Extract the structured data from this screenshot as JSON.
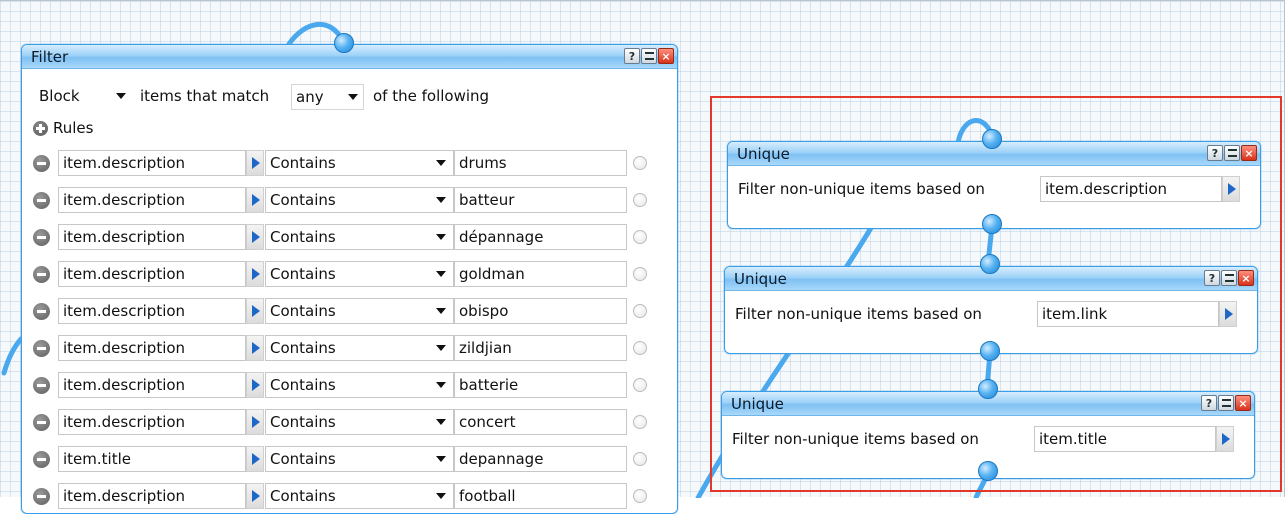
{
  "filter": {
    "title": "Filter",
    "mode_value": "Block",
    "text_items_that_match": "items that match",
    "match_value": "any",
    "text_of_the_following": "of the following",
    "rules_heading": "Rules",
    "rules": [
      {
        "field": "item.description",
        "operator": "Contains",
        "value": "drums"
      },
      {
        "field": "item.description",
        "operator": "Contains",
        "value": "batteur"
      },
      {
        "field": "item.description",
        "operator": "Contains",
        "value": "dépannage"
      },
      {
        "field": "item.description",
        "operator": "Contains",
        "value": "goldman"
      },
      {
        "field": "item.description",
        "operator": "Contains",
        "value": "obispo"
      },
      {
        "field": "item.description",
        "operator": "Contains",
        "value": "zildjian"
      },
      {
        "field": "item.description",
        "operator": "Contains",
        "value": "batterie"
      },
      {
        "field": "item.description",
        "operator": "Contains",
        "value": "concert"
      },
      {
        "field": "item.title",
        "operator": "Contains",
        "value": "depannage"
      },
      {
        "field": "item.description",
        "operator": "Contains",
        "value": "football"
      }
    ]
  },
  "unique_modules": [
    {
      "title": "Unique",
      "label": "Filter non-unique items based on",
      "field": "item.description"
    },
    {
      "title": "Unique",
      "label": "Filter non-unique items based on",
      "field": "item.link"
    },
    {
      "title": "Unique",
      "label": "Filter non-unique items based on",
      "field": "item.title"
    }
  ],
  "window_buttons": {
    "help": "?",
    "close": "×"
  },
  "colors": {
    "accent": "#3a9ee6",
    "titlebar": "#9fd2f8",
    "selection": "#e2372b",
    "arrow": "#1f67c6"
  },
  "icons": {
    "help": "help-icon",
    "minimize": "minimize-icon",
    "close": "close-icon",
    "add": "plus-circle-icon",
    "remove": "minus-circle-icon",
    "expand": "arrow-right-icon",
    "dropdown": "caret-down-icon"
  }
}
